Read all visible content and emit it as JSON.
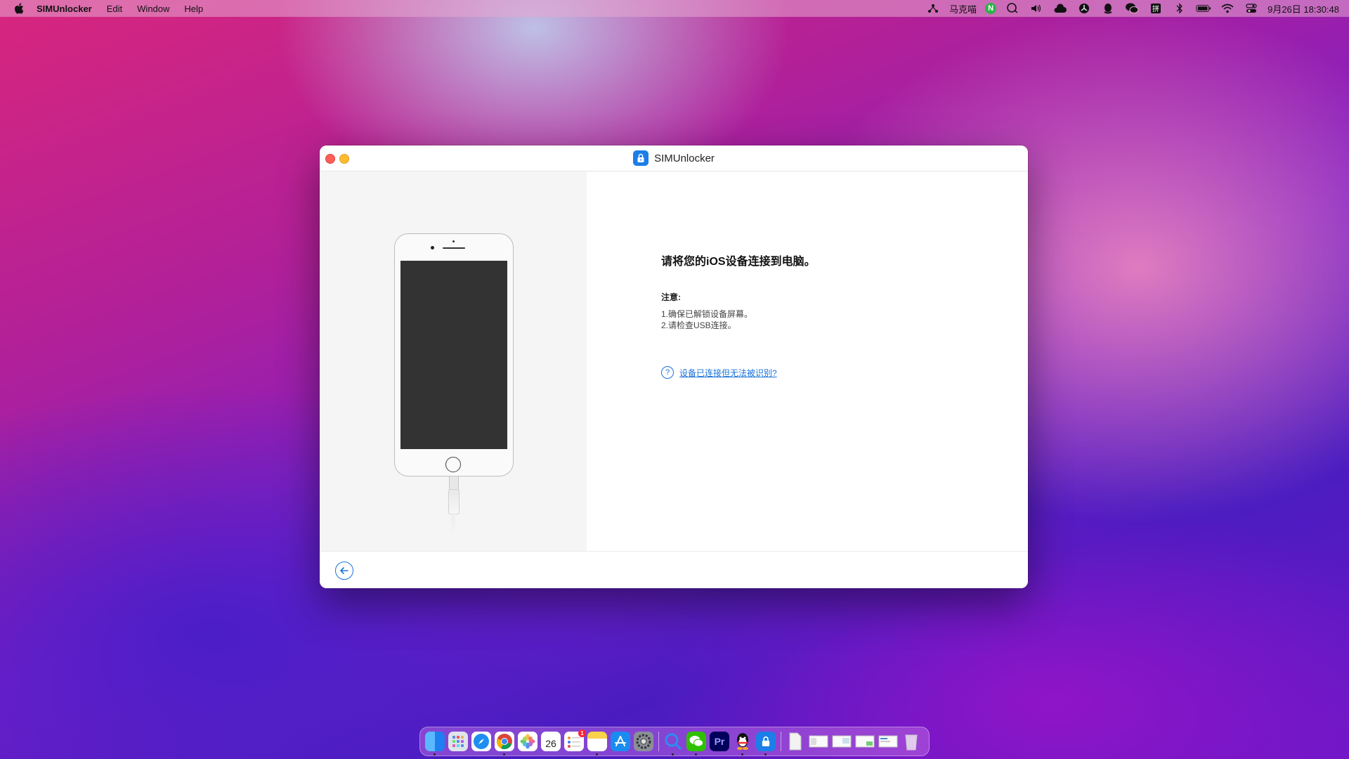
{
  "menubar": {
    "app_name": "SIMUnlocker",
    "menus": [
      "Edit",
      "Window",
      "Help"
    ],
    "tray_user": "马克喵",
    "tray_n": "N",
    "datetime": "9月26日  18:30:48"
  },
  "window": {
    "title": "SIMUnlocker",
    "heading": "请将您的iOS设备连接到电脑。",
    "note_title": "注意:",
    "note_lines": [
      "1.确保已解锁设备屏幕。",
      "2.请检查USB连接。"
    ],
    "help_link": "设备已连接但无法被识别?"
  },
  "dock": {
    "calendar_day": "26",
    "reminders_badge": "1",
    "premiere_label": "Pr"
  },
  "colors": {
    "accent": "#1a73d9",
    "close": "#fe5f57",
    "minimize": "#febc2e"
  }
}
